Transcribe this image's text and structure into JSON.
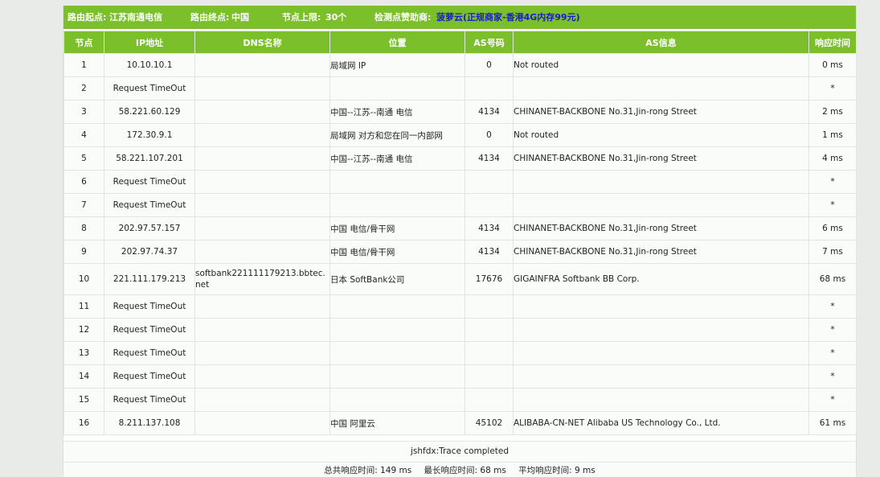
{
  "header": {
    "origin_label": "路由起点:",
    "origin_value": "江苏南通电信",
    "dest_label": "路由终点:",
    "dest_value": "中国",
    "hops_label": "节点上限:",
    "hops_value": "30个",
    "sponsor_label": "检测点赞助商:",
    "sponsor_name": "菠萝云",
    "sponsor_note": "(正规商家-香港4G内存99元)"
  },
  "columns": [
    "节点",
    "IP地址",
    "DNS名称",
    "位置",
    "AS号码",
    "AS信息",
    "响应时间"
  ],
  "rows": [
    {
      "hop": "1",
      "ip": "10.10.10.1",
      "dns": "",
      "loc": "局域网 IP",
      "asn": "0",
      "asinfo": "Not routed",
      "time": "0 ms"
    },
    {
      "hop": "2",
      "ip": "Request TimeOut",
      "dns": "",
      "loc": "",
      "asn": "",
      "asinfo": "",
      "time": "*"
    },
    {
      "hop": "3",
      "ip": "58.221.60.129",
      "dns": "",
      "loc": "中国--江苏--南通 电信",
      "asn": "4134",
      "asinfo": "CHINANET-BACKBONE No.31,Jin-rong Street",
      "time": "2 ms"
    },
    {
      "hop": "4",
      "ip": "172.30.9.1",
      "dns": "",
      "loc": "局域网 对方和您在同一内部网",
      "asn": "0",
      "asinfo": "Not routed",
      "time": "1 ms"
    },
    {
      "hop": "5",
      "ip": "58.221.107.201",
      "dns": "",
      "loc": "中国--江苏--南通 电信",
      "asn": "4134",
      "asinfo": "CHINANET-BACKBONE No.31,Jin-rong Street",
      "time": "4 ms"
    },
    {
      "hop": "6",
      "ip": "Request TimeOut",
      "dns": "",
      "loc": "",
      "asn": "",
      "asinfo": "",
      "time": "*"
    },
    {
      "hop": "7",
      "ip": "Request TimeOut",
      "dns": "",
      "loc": "",
      "asn": "",
      "asinfo": "",
      "time": "*"
    },
    {
      "hop": "8",
      "ip": "202.97.57.157",
      "dns": "",
      "loc": "中国 电信/骨干网",
      "asn": "4134",
      "asinfo": "CHINANET-BACKBONE No.31,Jin-rong Street",
      "time": "6 ms"
    },
    {
      "hop": "9",
      "ip": "202.97.74.37",
      "dns": "",
      "loc": "中国 电信/骨干网",
      "asn": "4134",
      "asinfo": "CHINANET-BACKBONE No.31,Jin-rong Street",
      "time": "7 ms"
    },
    {
      "hop": "10",
      "ip": "221.111.179.213",
      "dns": "softbank221111179213.bbtec.net",
      "loc": "日本 SoftBank公司",
      "asn": "17676",
      "asinfo": "GIGAINFRA Softbank BB Corp.",
      "time": "68 ms"
    },
    {
      "hop": "11",
      "ip": "Request TimeOut",
      "dns": "",
      "loc": "",
      "asn": "",
      "asinfo": "",
      "time": "*"
    },
    {
      "hop": "12",
      "ip": "Request TimeOut",
      "dns": "",
      "loc": "",
      "asn": "",
      "asinfo": "",
      "time": "*"
    },
    {
      "hop": "13",
      "ip": "Request TimeOut",
      "dns": "",
      "loc": "",
      "asn": "",
      "asinfo": "",
      "time": "*"
    },
    {
      "hop": "14",
      "ip": "Request TimeOut",
      "dns": "",
      "loc": "",
      "asn": "",
      "asinfo": "",
      "time": "*"
    },
    {
      "hop": "15",
      "ip": "Request TimeOut",
      "dns": "",
      "loc": "",
      "asn": "",
      "asinfo": "",
      "time": "*"
    },
    {
      "hop": "16",
      "ip": "8.211.137.108",
      "dns": "",
      "loc": "中国 阿里云",
      "asn": "45102",
      "asinfo": "ALIBABA-CN-NET Alibaba US Technology Co., Ltd.",
      "time": "61 ms"
    }
  ],
  "footer": {
    "status": "jshfdx:Trace completed",
    "total": "总共响应时间: 149 ms",
    "max": "最长响应时间: 68 ms",
    "avg": "平均响应时间: 9 ms"
  },
  "colors": {
    "accent": "#7bbf2a",
    "link": "#1a1acf",
    "row_bg": "#fafcfa",
    "grid": "#dfe7df"
  }
}
